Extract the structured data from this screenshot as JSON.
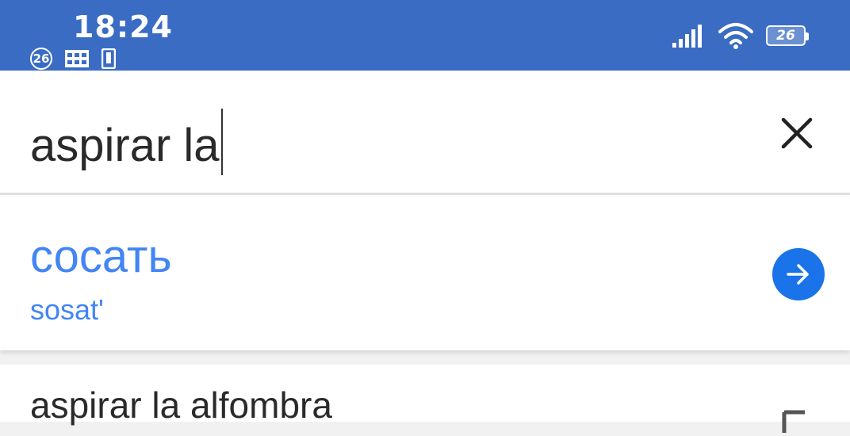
{
  "status_bar": {
    "time": "18:24",
    "notification_badge": "26",
    "battery_level": "26",
    "background_color": "#3a6cc4",
    "icons_left": [
      "numbered-notification-icon",
      "grid-icon",
      "phone-icon"
    ],
    "icons_right": [
      "signal-icon",
      "wifi-icon",
      "battery-icon"
    ]
  },
  "search": {
    "query": "aspirar la",
    "clear_icon": "close-icon"
  },
  "translation": {
    "text": "сосать",
    "transliteration": "sosat'",
    "accent_color": "#4285f4",
    "action_icon": "arrow-right-icon"
  },
  "suggestions": [
    {
      "text": "aspirar la alfombra",
      "icon": "fill-arrow-icon"
    }
  ]
}
